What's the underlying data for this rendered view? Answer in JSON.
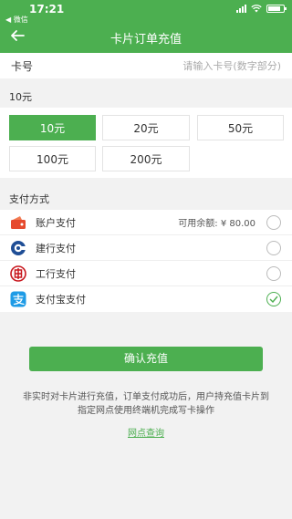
{
  "status_bar": {
    "time": "17:21",
    "back_app": "◀ 微信"
  },
  "header": {
    "title": "卡片订单充值"
  },
  "card_row": {
    "label": "卡号",
    "placeholder": "请输入卡号(数字部分)"
  },
  "amount_section": {
    "selected_label": "10元",
    "options": [
      "10元",
      "20元",
      "50元",
      "100元",
      "200元"
    ],
    "selected_index": 0
  },
  "payment": {
    "title": "支付方式",
    "methods": [
      {
        "label": "账户支付",
        "balance": "可用余额: ¥ 80.00",
        "icon": "account-wallet-icon",
        "checked": false
      },
      {
        "label": "建行支付",
        "balance": "",
        "icon": "ccb-bank-icon",
        "checked": false
      },
      {
        "label": "工行支付",
        "balance": "",
        "icon": "icbc-bank-icon",
        "checked": false
      },
      {
        "label": "支付宝支付",
        "balance": "",
        "icon": "alipay-icon",
        "checked": true
      }
    ]
  },
  "confirm_button": "确认充值",
  "notice": "非实时对卡片进行充值，订单支付成功后，用户持充值卡片到指定网点使用终端机完成写卡操作",
  "store_link": "网点查询",
  "colors": {
    "primary": "#4caf50",
    "ccb": "#1f4e96",
    "icbc": "#c8161d",
    "alipay": "#1e9be6",
    "account": "#e64a2e"
  }
}
